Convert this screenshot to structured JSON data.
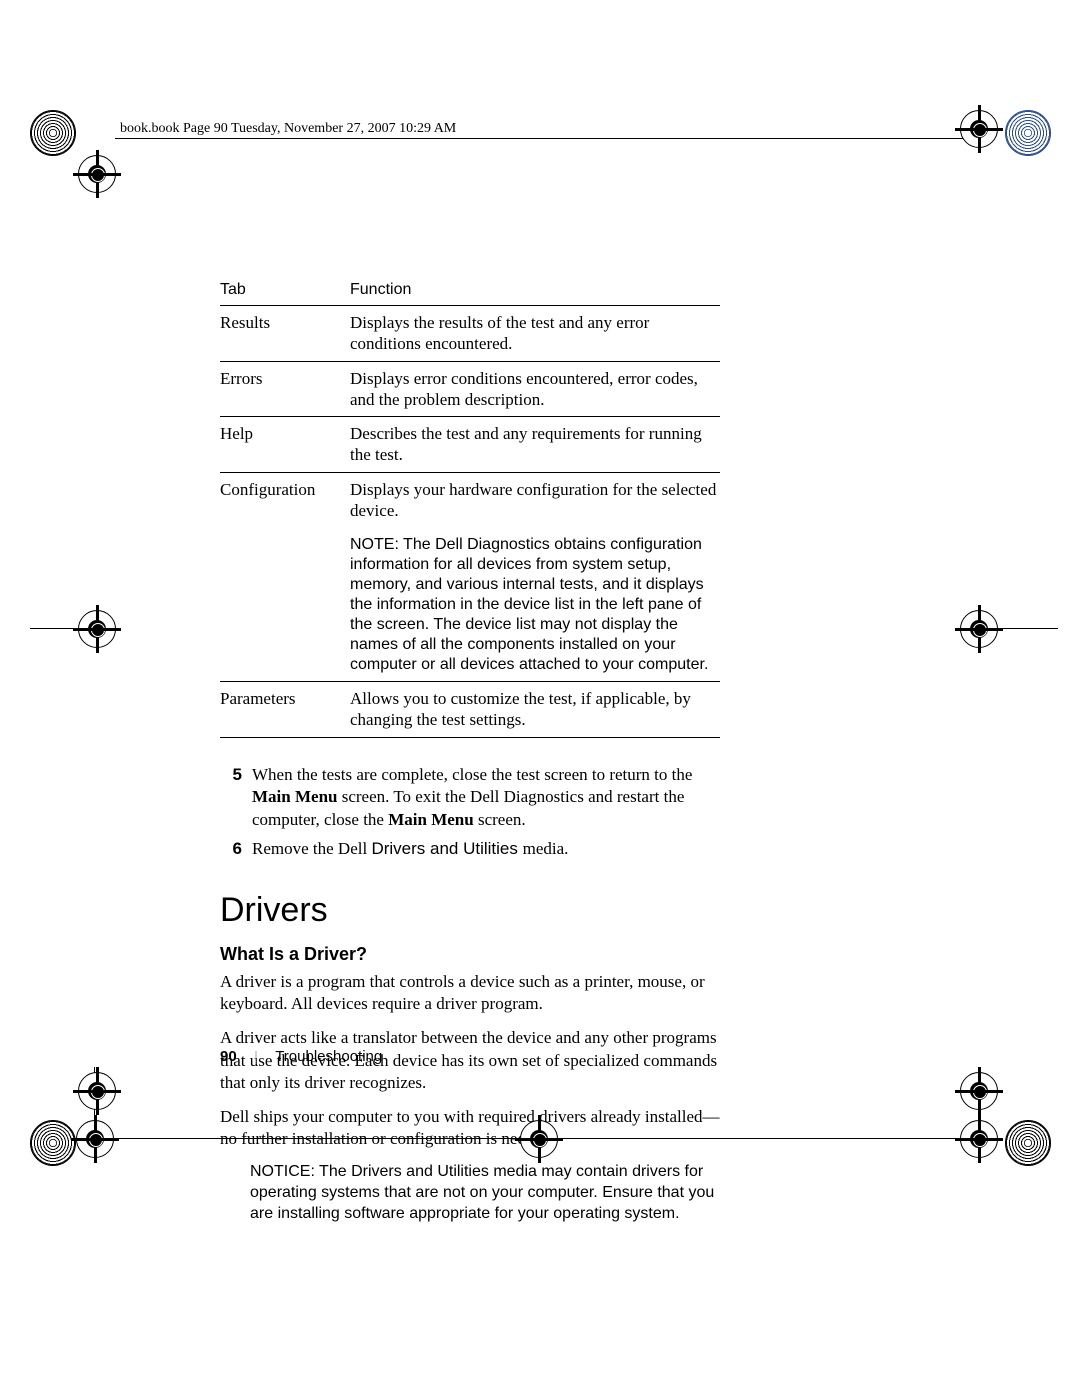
{
  "header": {
    "running": "book.book  Page 90  Tuesday, November 27, 2007  10:29 AM"
  },
  "table": {
    "col_tab": "Tab",
    "col_function": "Function",
    "rows": {
      "results": {
        "label": "Results",
        "desc": "Displays the results of the test and any error conditions encountered."
      },
      "errors": {
        "label": "Errors",
        "desc": "Displays error conditions encountered, error codes, and the problem description."
      },
      "help": {
        "label": "Help",
        "desc": "Describes the test and any requirements for running the test."
      },
      "configuration": {
        "label": "Configuration",
        "desc": "Displays your hardware configuration for the selected device.",
        "note_prefix": "NOTE: ",
        "note": "The Dell Diagnostics obtains configuration information for all devices from system setup, memory, and various internal tests, and it displays the information in the device list in the left pane of the screen. The device list may not display the names of all the components installed on your computer or all devices attached to your computer."
      },
      "parameters": {
        "label": "Parameters",
        "desc": "Allows you to customize the test, if applicable, by changing the test settings."
      }
    }
  },
  "steps": {
    "s5": {
      "num": "5",
      "pre": "When the tests are complete, close the test screen to return to the ",
      "bold1": "Main Menu",
      "mid": " screen. To exit the Dell Diagnostics and restart the computer, close the ",
      "bold2": "Main Menu",
      "post": " screen."
    },
    "s6": {
      "num": "6",
      "pre": "Remove the Dell ",
      "sans": "Drivers and Utilities ",
      "post": "media."
    }
  },
  "section": {
    "title": "Drivers",
    "sub": "What Is a Driver?",
    "p1": "A driver is a program that controls a device such as a printer, mouse, or keyboard. All devices require a driver program.",
    "p2": "A driver acts like a translator between the device and any other programs that use the device. Each device has its own set of specialized commands that only its driver recognizes.",
    "p3": "Dell ships your computer to you with required drivers already installed—no further installation or configuration is needed."
  },
  "notice": {
    "prefix": "NOTICE: ",
    "pre": "The ",
    "sans1": "Drivers and Utilities ",
    "mid": "media may contain drivers for operating systems that are not on your computer. Ensure that you are installing software appropriate for your operating system."
  },
  "footer": {
    "page": "90",
    "section": "Troubleshooting"
  }
}
